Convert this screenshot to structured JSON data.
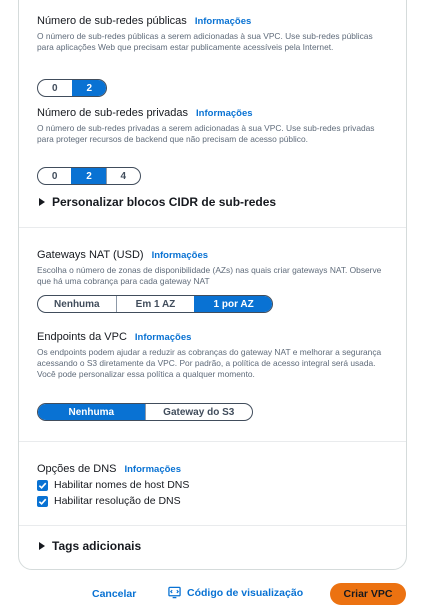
{
  "public_subnets": {
    "label": "Número de sub-redes públicas",
    "info": "Informações",
    "description": "O número de sub-redes públicas a serem adicionadas à sua VPC. Use sub-redes públicas para aplicações Web que precisam estar publicamente acessíveis pela Internet.",
    "options": [
      "0",
      "2"
    ],
    "selected": "2"
  },
  "private_subnets": {
    "label": "Número de sub-redes privadas",
    "info": "Informações",
    "description": "O número de sub-redes privadas a serem adicionadas à sua VPC. Use sub-redes privadas para proteger recursos de backend que não precisam de acesso público.",
    "options": [
      "0",
      "2",
      "4"
    ],
    "selected": "2"
  },
  "cidr_expander": {
    "label": "Personalizar blocos CIDR de sub-redes"
  },
  "nat_gateways": {
    "label": "Gateways NAT (USD)",
    "info": "Informações",
    "description": "Escolha o número de zonas de disponibilidade (AZs) nas quais criar gateways NAT. Observe que há uma cobrança para cada gateway NAT",
    "options": [
      "Nenhuma",
      "Em 1 AZ",
      "1 por AZ"
    ],
    "selected": "1 por AZ"
  },
  "vpc_endpoints": {
    "label": "Endpoints da VPC",
    "info": "Informações",
    "description": "Os endpoints podem ajudar a reduzir as cobranças do gateway NAT e melhorar a segurança acessando o S3 diretamente da VPC. Por padrão, a política de acesso integral será usada. Você pode personalizar essa política a qualquer momento.",
    "options": [
      "Nenhuma",
      "Gateway do S3"
    ],
    "selected": "Nenhuma"
  },
  "dns_options": {
    "label": "Opções de DNS",
    "info": "Informações",
    "items": [
      {
        "label": "Habilitar nomes de host DNS",
        "checked": true
      },
      {
        "label": "Habilitar resolução de DNS",
        "checked": true
      }
    ]
  },
  "tags_expander": {
    "label": "Tags adicionais"
  },
  "footer": {
    "cancel": "Cancelar",
    "preview": "Código de visualização",
    "create": "Criar VPC"
  },
  "colors": {
    "accent": "#0972d3",
    "primary_button": "#ec7211"
  }
}
